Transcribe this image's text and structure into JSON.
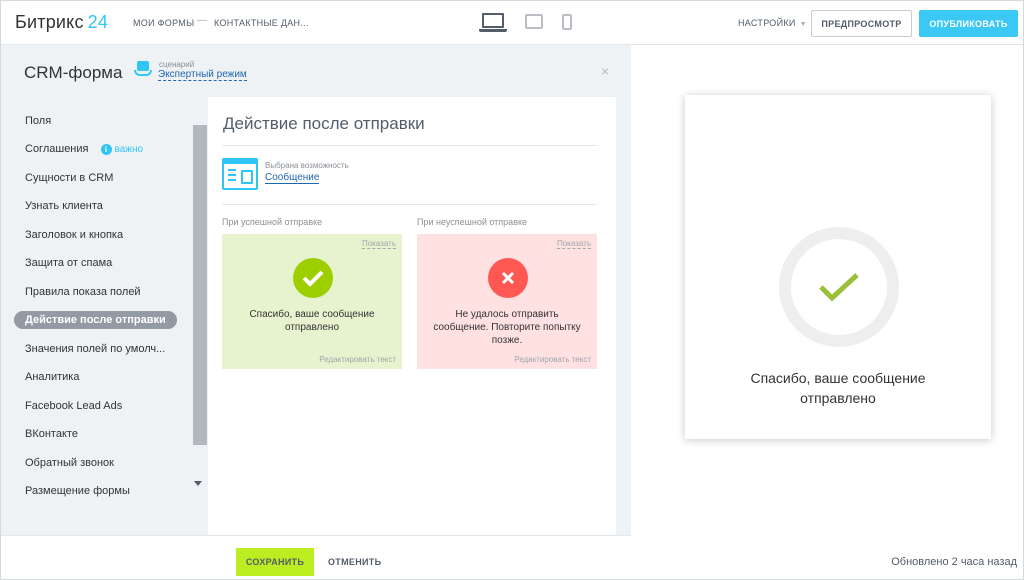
{
  "topbar": {
    "logo_text": "Битрикс",
    "logo_number": "24",
    "crumb_forms": "МОИ ФОРМЫ",
    "crumb_sep": "—",
    "crumb_contacts": "КОНТАКТНЫЕ ДАН...",
    "settings_label": "НАСТРОЙКИ",
    "preview_label": "ПРЕДПРОСМОТР",
    "publish_label": "ОПУБЛИКОВАТЬ"
  },
  "editor": {
    "title": "CRM-форма",
    "scenario_caption": "сценарий",
    "scenario_value": "Экспертный режим",
    "close_glyph": "×"
  },
  "sidebar": {
    "items": [
      {
        "label": "Поля"
      },
      {
        "label": "Соглашения"
      },
      {
        "label": "Сущности в CRM"
      },
      {
        "label": "Узнать клиента"
      },
      {
        "label": "Заголовок и кнопка"
      },
      {
        "label": "Защита от спама"
      },
      {
        "label": "Правила показа полей"
      },
      {
        "label": "Действие после отправки"
      },
      {
        "label": "Значения полей по умолч..."
      },
      {
        "label": "Аналитика"
      },
      {
        "label": "Facebook Lead Ads"
      },
      {
        "label": "ВКонтакте"
      },
      {
        "label": "Обратный звонок"
      },
      {
        "label": "Размещение формы"
      }
    ],
    "important_label": "важно",
    "important_icon": "i"
  },
  "content": {
    "title": "Действие после отправки",
    "feature_caption": "Выбрана возможность",
    "feature_value": "Сообщение",
    "success": {
      "column_label": "При успешной отправке",
      "show_link": "Показать",
      "message": "Спасибо, ваше сообщение отправлено",
      "edit_link": "Редактировать текст"
    },
    "failure": {
      "column_label": "При неуспешной отправке",
      "show_link": "Показать",
      "message": "Не удалось отправить сообщение. Повторите попытку позже.",
      "edit_link": "Редактировать текст"
    }
  },
  "footer": {
    "save_label": "СОХРАНИТЬ",
    "cancel_label": "ОТМЕНИТЬ"
  },
  "preview": {
    "message": "Спасибо, ваше сообщение отправлено",
    "updated": "Обновлено 2 часа назад"
  },
  "colors": {
    "accent": "#2fc6f6",
    "success": "#9dcf00",
    "error": "#ff5752",
    "save": "#bbed21"
  }
}
